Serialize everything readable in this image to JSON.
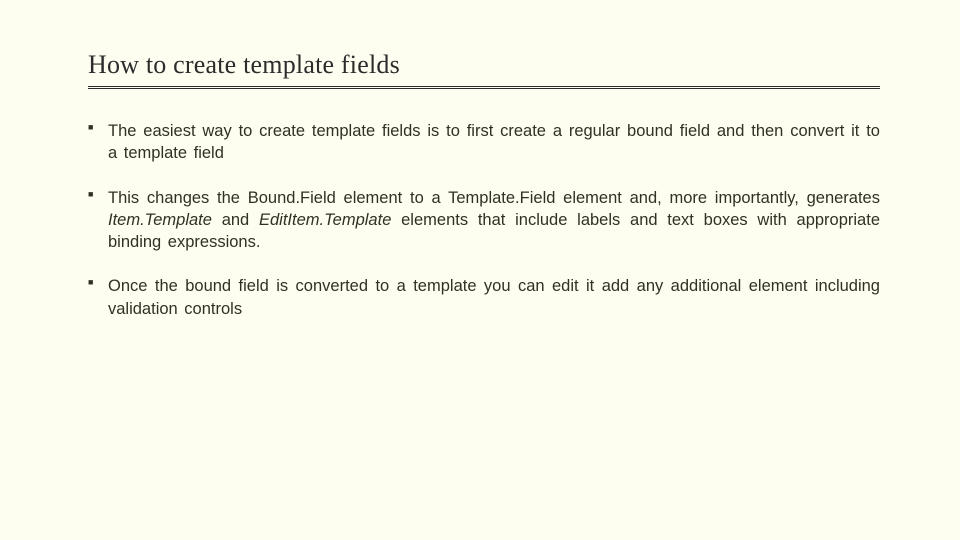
{
  "slide": {
    "title": "How to create template fields",
    "bullets": [
      {
        "text": "The easiest way to create template fields is to first create a regular bound field and then convert it to a template field"
      },
      {
        "pre": "This changes the Bound.Field element to a Template.Field element and, more importantly, generates ",
        "em1": "Item.Template",
        "mid": " and ",
        "em2": "EditItem.Template",
        "post": " elements that include labels and text boxes with appropriate binding expressions."
      },
      {
        "text": "Once the bound field is converted to a template you can edit it add any additional element including validation controls"
      }
    ]
  }
}
